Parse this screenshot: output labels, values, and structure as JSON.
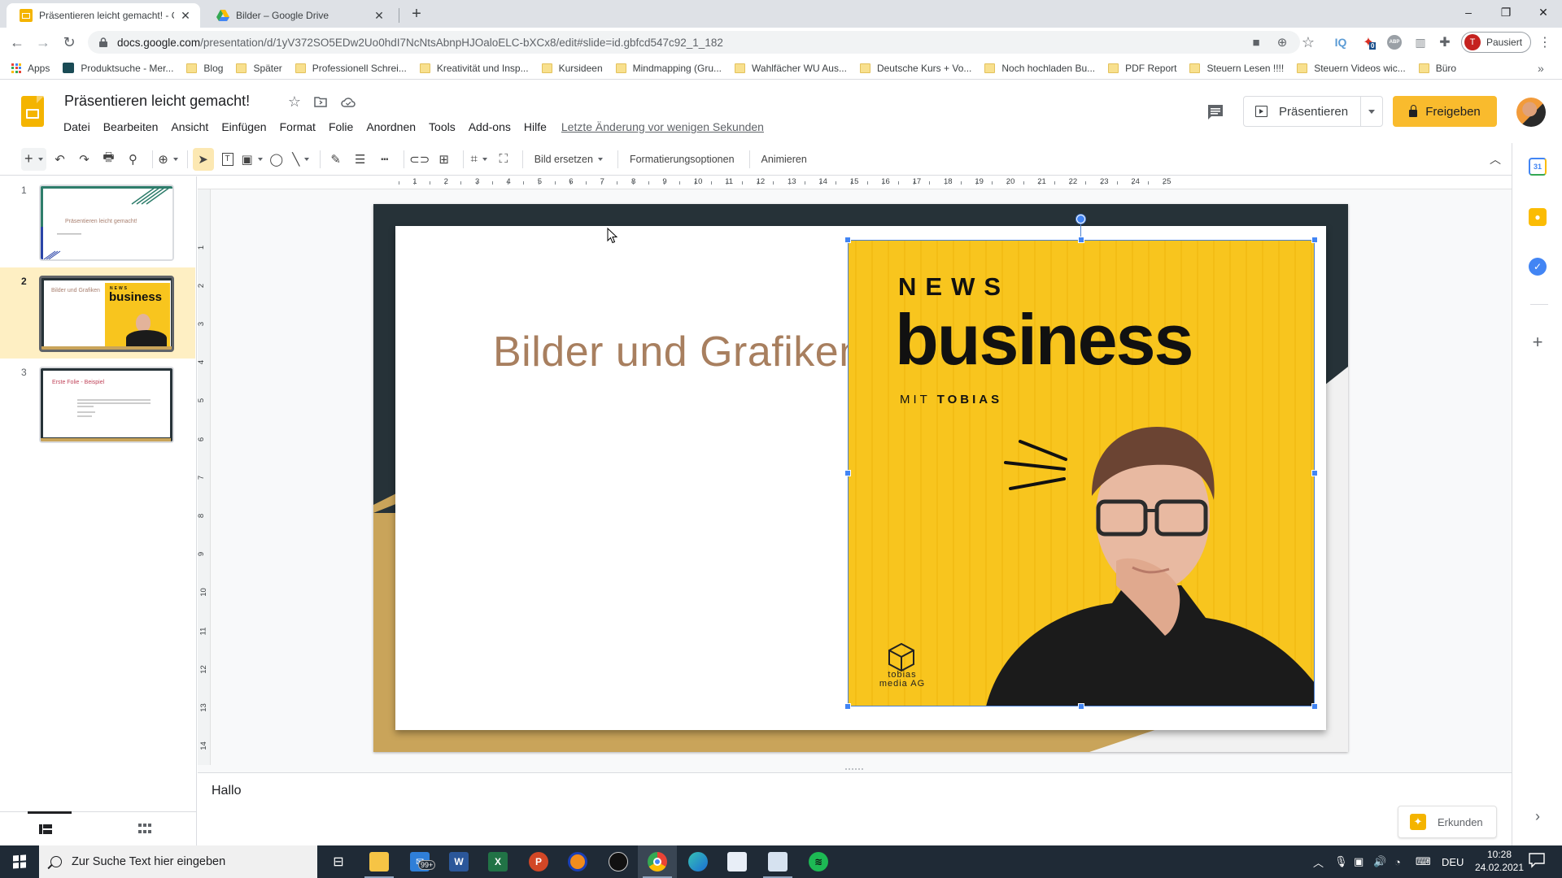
{
  "browser": {
    "tabs": [
      {
        "title": "Präsentieren leicht gemacht! - Goo",
        "active": true,
        "favicon": "google-slides-icon"
      },
      {
        "title": "Bilder – Google Drive",
        "active": false,
        "favicon": "google-drive-icon"
      }
    ],
    "new_tab_label": "+",
    "window_controls": {
      "minimize": "–",
      "restore": "❐",
      "close": "✕"
    },
    "url": {
      "host": "docs.google.com",
      "path": "/presentation/d/1yV372SO5EDw2Uo0hdI7NcNtsAbnpHJOaloELC-bXCx8/edit#slide=id.gbfcd547c92_1_182"
    },
    "extensions": [
      {
        "name": "camera-icon",
        "glyph": "■"
      },
      {
        "name": "zoom-icon",
        "glyph": "⊕"
      },
      {
        "name": "bookmark-star-icon",
        "glyph": "☆"
      },
      {
        "name": "iq-extension-icon",
        "glyph": "IQ"
      },
      {
        "name": "bird-extension-icon",
        "glyph": "✦",
        "badge": "0"
      },
      {
        "name": "adblock-icon",
        "glyph": "ABP"
      },
      {
        "name": "stats-extension-icon",
        "glyph": "▥"
      },
      {
        "name": "extensions-puzzle-icon",
        "glyph": "✚"
      }
    ],
    "profile": {
      "initial": "T",
      "status": "Pausiert"
    },
    "menu_glyph": "⋮"
  },
  "bookmarks": {
    "apps_label": "Apps",
    "items": [
      {
        "label": "Produktsuche - Mer...",
        "type": "site"
      },
      {
        "label": "Blog",
        "type": "folder"
      },
      {
        "label": "Später",
        "type": "folder"
      },
      {
        "label": "Professionell Schrei...",
        "type": "folder"
      },
      {
        "label": "Kreativität und Insp...",
        "type": "folder"
      },
      {
        "label": "Kursideen",
        "type": "folder"
      },
      {
        "label": "Mindmapping  (Gru...",
        "type": "folder"
      },
      {
        "label": "Wahlfächer WU Aus...",
        "type": "folder"
      },
      {
        "label": "Deutsche Kurs + Vo...",
        "type": "folder"
      },
      {
        "label": "Noch hochladen Bu...",
        "type": "folder"
      },
      {
        "label": "PDF Report",
        "type": "folder"
      },
      {
        "label": "Steuern Lesen !!!!",
        "type": "folder"
      },
      {
        "label": "Steuern Videos wic...",
        "type": "folder"
      },
      {
        "label": "Büro",
        "type": "folder"
      }
    ],
    "overflow": "»"
  },
  "docs": {
    "title": "Präsentieren leicht gemacht!",
    "menu": [
      "Datei",
      "Bearbeiten",
      "Ansicht",
      "Einfügen",
      "Format",
      "Folie",
      "Anordnen",
      "Tools",
      "Add-ons",
      "Hilfe"
    ],
    "last_edit": "Letzte Änderung vor wenigen Sekunden",
    "present_label": "Präsentieren",
    "share_label": "Freigeben",
    "accent": "#f9bb2d"
  },
  "toolbar": {
    "buttons": {
      "replace_image": "Bild ersetzen",
      "format_options": "Formatierungsoptionen",
      "animate": "Animieren"
    }
  },
  "ruler": {
    "horizontal": [
      "1",
      "2",
      "3",
      "4",
      "5",
      "6",
      "7",
      "8",
      "9",
      "10",
      "11",
      "12",
      "13",
      "14",
      "15",
      "16",
      "17",
      "18",
      "19",
      "20",
      "21",
      "22",
      "23",
      "24",
      "25"
    ],
    "vertical": [
      "1",
      "2",
      "3",
      "4",
      "5",
      "6",
      "7",
      "8",
      "9",
      "10",
      "11",
      "12",
      "13",
      "14"
    ]
  },
  "filmstrip": {
    "slides": [
      {
        "number": "1",
        "title": "Präsentieren leicht gemacht!",
        "selected": false
      },
      {
        "number": "2",
        "title": "Bilder und Grafiken",
        "selected": true
      },
      {
        "number": "3",
        "title": "Erste Folie - Beispiel",
        "selected": false
      }
    ]
  },
  "slide": {
    "title": "Bilder und Grafiken",
    "image": {
      "headline_small": "NEWS",
      "headline_big": "business",
      "byline_prefix": "MIT",
      "byline_name": "TOBIAS",
      "brand_line1": "tobias",
      "brand_line2": "media AG"
    }
  },
  "notes": {
    "text": "Hallo"
  },
  "explore_label": "Erkunden",
  "taskbar": {
    "search_placeholder": "Zur Suche Text hier eingeben",
    "mail_badge": "99+",
    "language": "DEU",
    "time": "10:28",
    "date": "24.02.2021"
  }
}
